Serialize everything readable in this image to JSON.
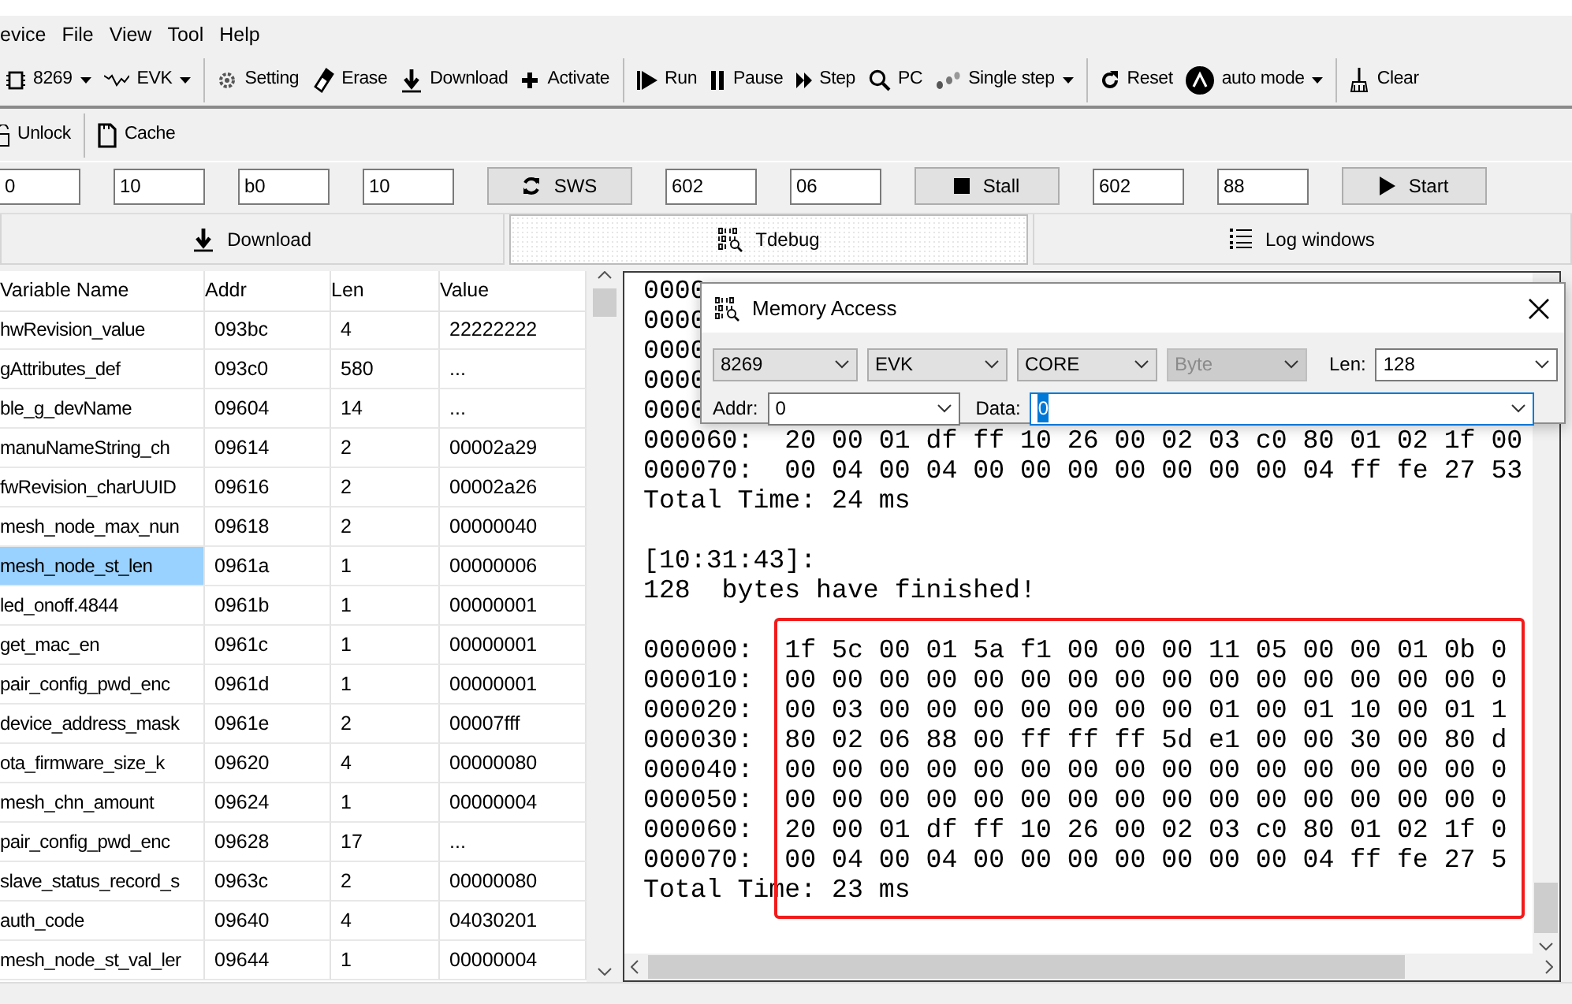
{
  "menu": [
    {
      "label": "evice"
    },
    {
      "label": "File"
    },
    {
      "label": "View"
    },
    {
      "label": "Tool"
    },
    {
      "label": "Help"
    }
  ],
  "toolbar": [
    {
      "kind": "dropdown",
      "label": "8269"
    },
    {
      "kind": "dropdown",
      "label": "EVK"
    },
    {
      "kind": "separator"
    },
    {
      "kind": "button",
      "label": "Setting"
    },
    {
      "kind": "button",
      "label": "Erase"
    },
    {
      "kind": "button",
      "label": "Download"
    },
    {
      "kind": "button",
      "label": "Activate"
    },
    {
      "kind": "separator"
    },
    {
      "kind": "button",
      "label": "Run"
    },
    {
      "kind": "button",
      "label": "Pause"
    },
    {
      "kind": "button",
      "label": "Step"
    },
    {
      "kind": "button",
      "label": "PC"
    },
    {
      "kind": "dropdown",
      "label": "Single step"
    },
    {
      "kind": "separator"
    },
    {
      "kind": "button",
      "label": "Reset"
    },
    {
      "kind": "dropdown",
      "label": "auto mode"
    },
    {
      "kind": "separator"
    },
    {
      "kind": "button",
      "label": "Clear"
    }
  ],
  "toolbar_2": [
    {
      "kind": "button",
      "label": "Unlock"
    },
    {
      "kind": "separator"
    },
    {
      "kind": "button",
      "label": "Cache"
    }
  ],
  "params": [
    {
      "kind": "field",
      "value": "0"
    },
    {
      "kind": "field",
      "value": "10"
    },
    {
      "kind": "field",
      "value": "b0"
    },
    {
      "kind": "field",
      "value": "10"
    },
    {
      "kind": "button",
      "label": "SWS"
    },
    {
      "kind": "field",
      "value": "602"
    },
    {
      "kind": "field",
      "value": "06"
    },
    {
      "kind": "button",
      "label": "Stall"
    },
    {
      "kind": "field",
      "value": "602"
    },
    {
      "kind": "field",
      "value": "88"
    },
    {
      "kind": "button",
      "label": "Start"
    }
  ],
  "tabs": [
    {
      "label": "Download",
      "selected": false
    },
    {
      "label": "Tdebug",
      "selected": true
    },
    {
      "label": "Log windows",
      "selected": false
    }
  ],
  "table": {
    "columns": [
      "Variable Name",
      "Addr",
      "Len",
      "Value"
    ],
    "rows": [
      {
        "cells": [
          "hwRevision_value",
          "093bc",
          "4",
          "22222222"
        ],
        "selected": false
      },
      {
        "cells": [
          "gAttributes_def",
          "093c0",
          "580",
          "..."
        ],
        "selected": false
      },
      {
        "cells": [
          "ble_g_devName",
          "09604",
          "14",
          "..."
        ],
        "selected": false
      },
      {
        "cells": [
          "manuNameString_ch",
          "09614",
          "2",
          "00002a29"
        ],
        "selected": false
      },
      {
        "cells": [
          "fwRevision_charUUID",
          "09616",
          "2",
          "00002a26"
        ],
        "selected": false
      },
      {
        "cells": [
          "mesh_node_max_nun",
          "09618",
          "2",
          "00000040"
        ],
        "selected": false
      },
      {
        "cells": [
          "mesh_node_st_len",
          "0961a",
          "1",
          "00000006"
        ],
        "selected": true
      },
      {
        "cells": [
          "led_onoff.4844",
          "0961b",
          "1",
          "00000001"
        ],
        "selected": false
      },
      {
        "cells": [
          "get_mac_en",
          "0961c",
          "1",
          "00000001"
        ],
        "selected": false
      },
      {
        "cells": [
          "pair_config_pwd_enc",
          "0961d",
          "1",
          "00000001"
        ],
        "selected": false
      },
      {
        "cells": [
          "device_address_mask",
          "0961e",
          "2",
          "00007fff"
        ],
        "selected": false
      },
      {
        "cells": [
          "ota_firmware_size_k",
          "09620",
          "4",
          "00000080"
        ],
        "selected": false
      },
      {
        "cells": [
          "mesh_chn_amount",
          "09624",
          "1",
          "00000004"
        ],
        "selected": false
      },
      {
        "cells": [
          "pair_config_pwd_enc",
          "09628",
          "17",
          "..."
        ],
        "selected": false
      },
      {
        "cells": [
          "slave_status_record_s",
          "0963c",
          "2",
          "00000080"
        ],
        "selected": false
      },
      {
        "cells": [
          "auth_code",
          "09640",
          "4",
          "04030201"
        ],
        "selected": false
      },
      {
        "cells": [
          "mesh_node_st_val_ler",
          "09644",
          "1",
          "00000004"
        ],
        "selected": false
      }
    ]
  },
  "console": {
    "blocks": [
      {
        "lines": [
          "0000",
          "0000",
          "0000",
          "0000",
          "0000",
          "000060:  20 00 01 df ff 10 26 00 02 03 c0 80 01 02 1f 00",
          "000070:  00 04 00 04 00 00 00 00 00 00 00 04 ff fe 27 53",
          "Total Time: 24 ms"
        ]
      },
      {
        "lines": [
          "[10:31:43]:",
          "128  bytes have finished!"
        ]
      },
      {
        "lines": [
          "000000:  1f 5c 00 01 5a f1 00 00 00 11 05 00 00 01 0b 0",
          "000010:  00 00 00 00 00 00 00 00 00 00 00 00 00 00 00 0",
          "000020:  00 03 00 00 00 00 00 00 00 01 00 01 10 00 01 1",
          "000030:  80 02 06 88 00 ff ff ff 5d e1 00 00 30 00 80 d",
          "000040:  00 00 00 00 00 00 00 00 00 00 00 00 00 00 00 0",
          "000050:  00 00 00 00 00 00 00 00 00 00 00 00 00 00 00 0",
          "000060:  20 00 01 df ff 10 26 00 02 03 c0 80 01 02 1f 0",
          "000070:  00 04 00 04 00 00 00 00 00 00 00 04 ff fe 27 5",
          "Total Time: 23 ms"
        ]
      }
    ]
  },
  "dialog": {
    "title": "Memory Access",
    "selects": [
      {
        "value": "8269",
        "disabled": false
      },
      {
        "value": "EVK",
        "disabled": false
      },
      {
        "value": "CORE",
        "disabled": false
      },
      {
        "value": "Byte",
        "disabled": true
      }
    ],
    "len": {
      "label": "Len:",
      "value": "128"
    },
    "addr": {
      "label": "Addr:",
      "value": "0",
      "focused": false
    },
    "data": {
      "label": "Data:",
      "value": "0",
      "focused": true
    }
  }
}
